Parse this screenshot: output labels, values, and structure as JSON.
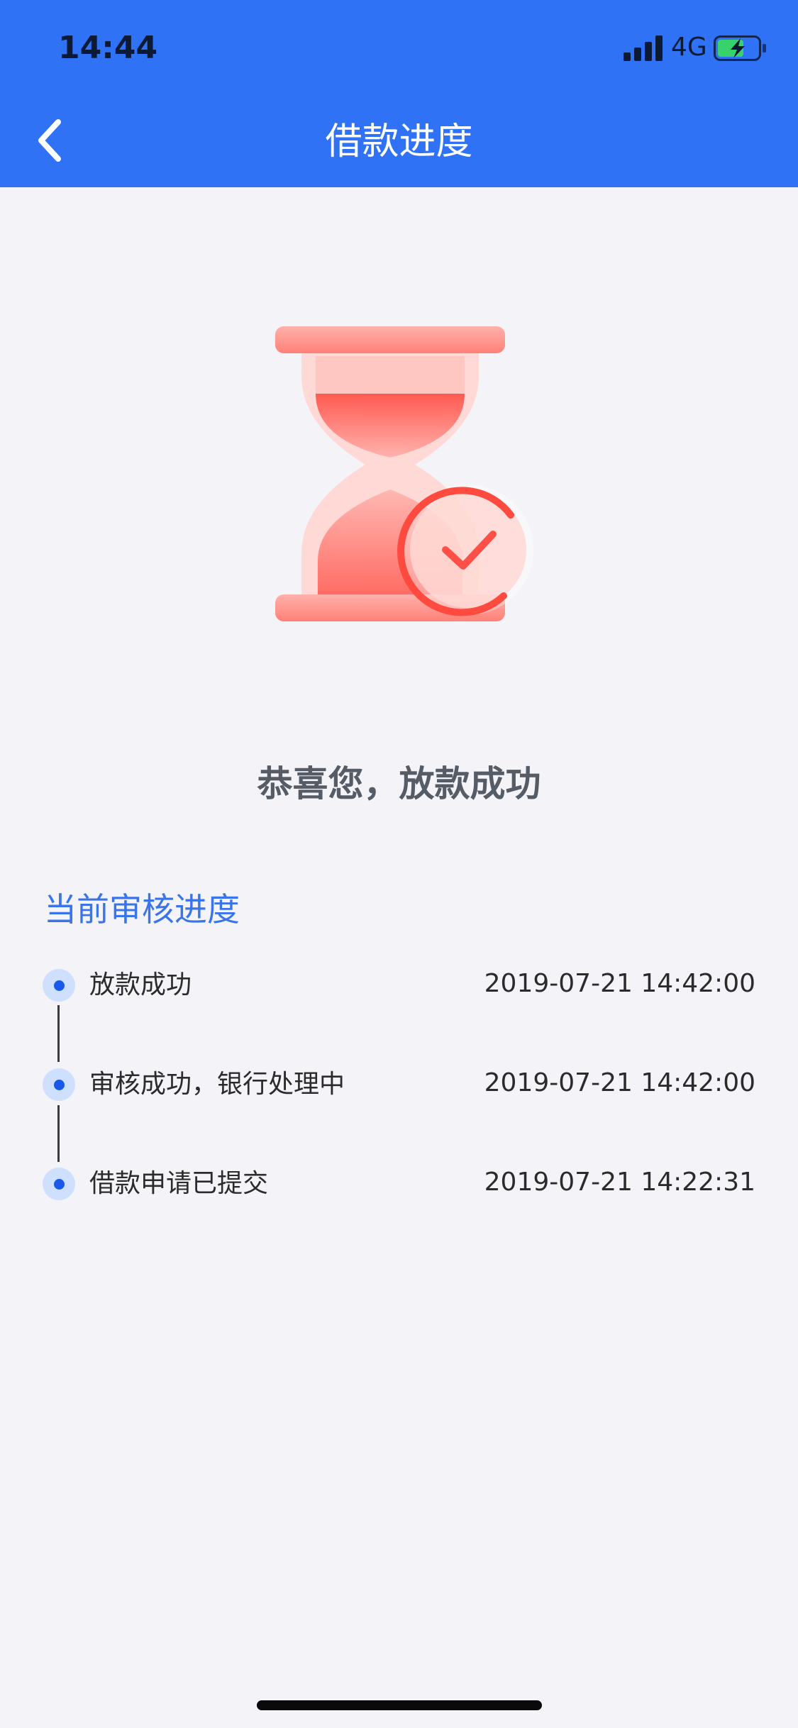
{
  "status_bar": {
    "time": "14:44",
    "network": "4G",
    "signal_bars": 4,
    "battery_level": 0.6,
    "icons": [
      "signal-icon",
      "battery-charging-icon"
    ]
  },
  "nav": {
    "title": "借款进度",
    "back_icon": "chevron-left-icon"
  },
  "hero": {
    "icon": "hourglass-check-icon",
    "message": "恭喜您，放款成功"
  },
  "progress": {
    "title": "当前审核进度",
    "steps": [
      {
        "label": "放款成功",
        "time": "2019-07-21 14:42:00"
      },
      {
        "label": "审核成功，银行处理中",
        "time": "2019-07-21 14:42:00"
      },
      {
        "label": "借款申请已提交",
        "time": "2019-07-21 14:22:31"
      }
    ]
  },
  "colors": {
    "primary": "#2f72f6",
    "background": "#f4f4f8",
    "accent_text": "#3a74ea",
    "hourglass": "#ff6b62",
    "dot": "#1958e8",
    "dot_ring": "#cfe0ff"
  }
}
